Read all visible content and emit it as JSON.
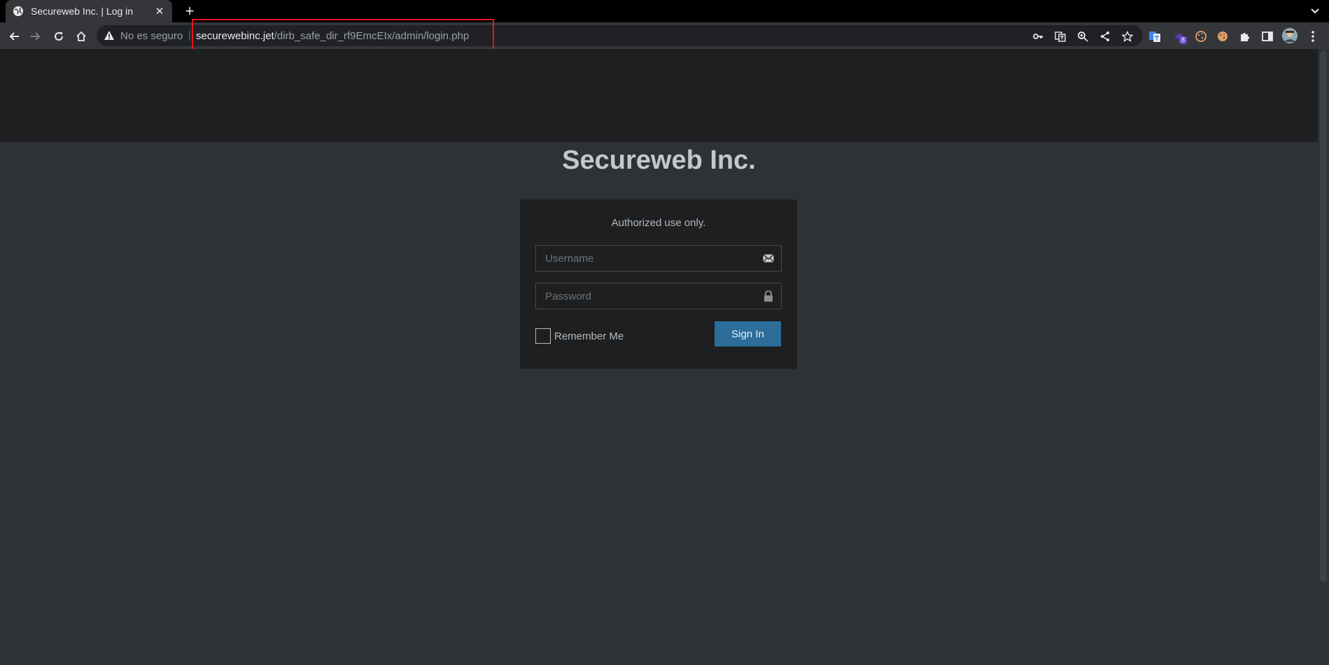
{
  "browser": {
    "tab": {
      "title": "Secureweb Inc. | Log in",
      "favicon": "globe-icon"
    },
    "new_tab_label": "+",
    "omnibox": {
      "security_label": "No es seguro",
      "separator": "|",
      "url_host": "securewebinc.jet",
      "url_path": "/dirb_safe_dir_rf9EmcEIx/admin/login.php"
    },
    "extension_badge": "8",
    "highlight_color": "#e8141c"
  },
  "page": {
    "site_title": "Secureweb Inc.",
    "login": {
      "message": "Authorized use only.",
      "username_placeholder": "Username",
      "password_placeholder": "Password",
      "remember_label": "Remember Me",
      "signin_label": "Sign In"
    },
    "colors": {
      "header_bg": "#1d1f21",
      "body_bg": "#2e3236",
      "button_bg": "#2d6d99"
    }
  }
}
